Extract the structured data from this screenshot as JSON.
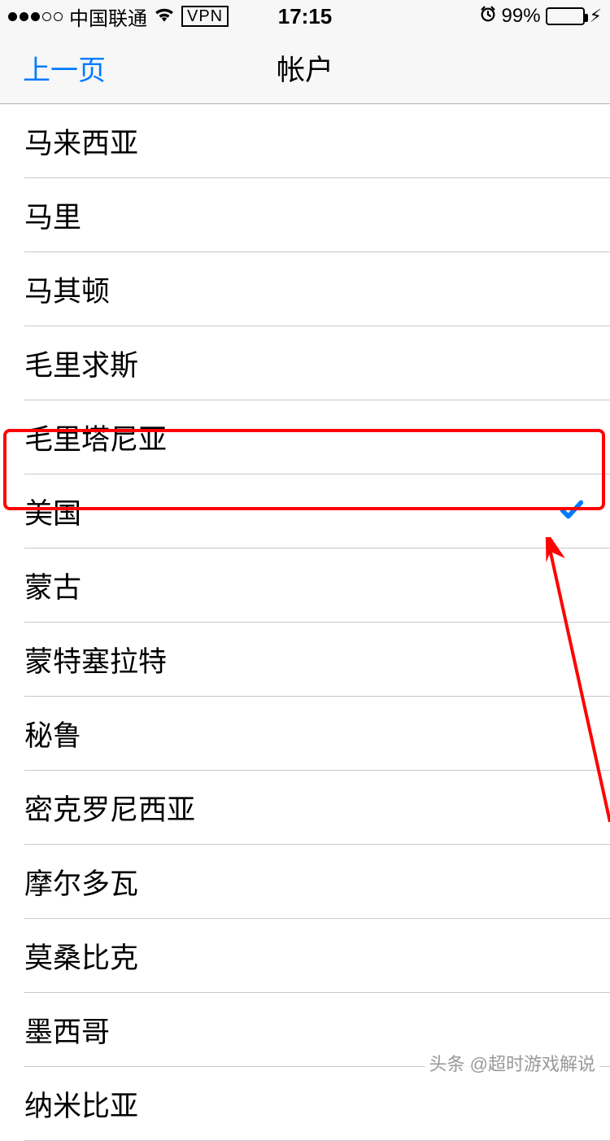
{
  "status": {
    "carrier": "中国联通",
    "vpn": "VPN",
    "time": "17:15",
    "battery_pct": "99%"
  },
  "nav": {
    "back": "上一页",
    "title": "帐户"
  },
  "countries": [
    {
      "label": "马来西亚",
      "selected": false
    },
    {
      "label": "马里",
      "selected": false
    },
    {
      "label": "马其顿",
      "selected": false
    },
    {
      "label": "毛里求斯",
      "selected": false
    },
    {
      "label": "毛里塔尼亚",
      "selected": false
    },
    {
      "label": "美国",
      "selected": true
    },
    {
      "label": "蒙古",
      "selected": false
    },
    {
      "label": "蒙特塞拉特",
      "selected": false
    },
    {
      "label": "秘鲁",
      "selected": false
    },
    {
      "label": "密克罗尼西亚",
      "selected": false
    },
    {
      "label": "摩尔多瓦",
      "selected": false
    },
    {
      "label": "莫桑比克",
      "selected": false
    },
    {
      "label": "墨西哥",
      "selected": false
    },
    {
      "label": "纳米比亚",
      "selected": false
    }
  ],
  "watermark": "头条 @超时游戏解说"
}
